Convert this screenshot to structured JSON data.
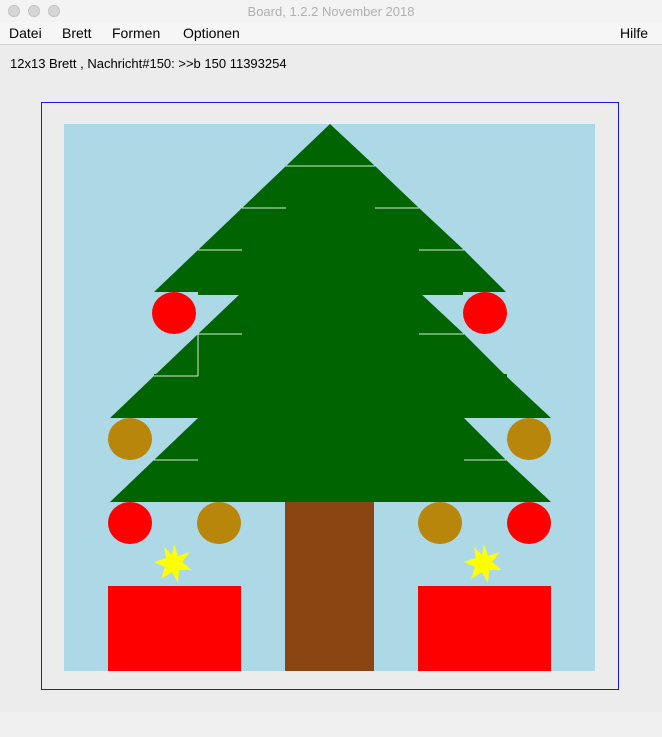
{
  "window": {
    "title": "Board, 1.2.2 November 2018"
  },
  "menubar": {
    "items": [
      "Datei",
      "Brett",
      "Formen",
      "Optionen"
    ],
    "help": "Hilfe"
  },
  "status": {
    "text": "12x13 Brett , Nachricht#150: >>b 150 11393254"
  },
  "board": {
    "columns": 12,
    "rows": 13,
    "background_color": "#add8e6",
    "frame_color": "#1a1adf",
    "scene": {
      "tree_color": "#006400",
      "trunk_color": "#8b4513",
      "ornament_red": "#ff0000",
      "ornament_gold": "#b8860b",
      "gift_color": "#ff0000",
      "star_color": "#ffff00"
    }
  }
}
